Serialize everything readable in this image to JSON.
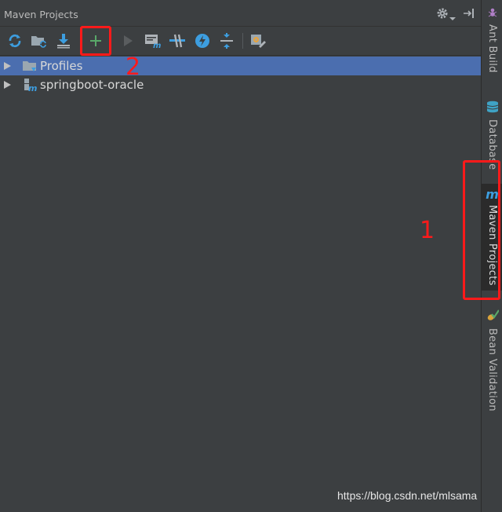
{
  "panel": {
    "title": "Maven Projects"
  },
  "toolbar": {
    "tools": [
      {
        "name": "reimport-all-icon"
      },
      {
        "name": "generate-sources-icon"
      },
      {
        "name": "download-sources-icon"
      },
      {
        "name": "add-maven-project-icon"
      },
      {
        "name": "run-maven-build-icon"
      },
      {
        "name": "execute-goal-icon"
      },
      {
        "name": "toggle-offline-icon"
      },
      {
        "name": "skip-tests-icon"
      },
      {
        "name": "collapse-all-icon"
      },
      {
        "name": "settings-icon"
      }
    ]
  },
  "tree": {
    "items": [
      {
        "label": "Profiles",
        "icon": "profiles-folder-icon",
        "selected": true
      },
      {
        "label": "springboot-oracle",
        "icon": "maven-module-icon",
        "selected": false
      }
    ]
  },
  "rightbar": {
    "tabs": [
      {
        "label": "Ant Build",
        "icon": "ant-icon",
        "active": false
      },
      {
        "label": "Database",
        "icon": "database-icon",
        "active": false
      },
      {
        "label": "Maven Projects",
        "icon": "maven-icon",
        "active": true
      },
      {
        "label": "Bean Validation",
        "icon": "bean-validation-icon",
        "active": false
      }
    ]
  },
  "annotations": {
    "one": "1",
    "two": "2",
    "color": "#ff1a1a"
  },
  "watermark": "https://blog.csdn.net/mlsama",
  "colors": {
    "background": "#3c3f41",
    "selection": "#4b6eaf",
    "text": "#bbbbbb"
  }
}
